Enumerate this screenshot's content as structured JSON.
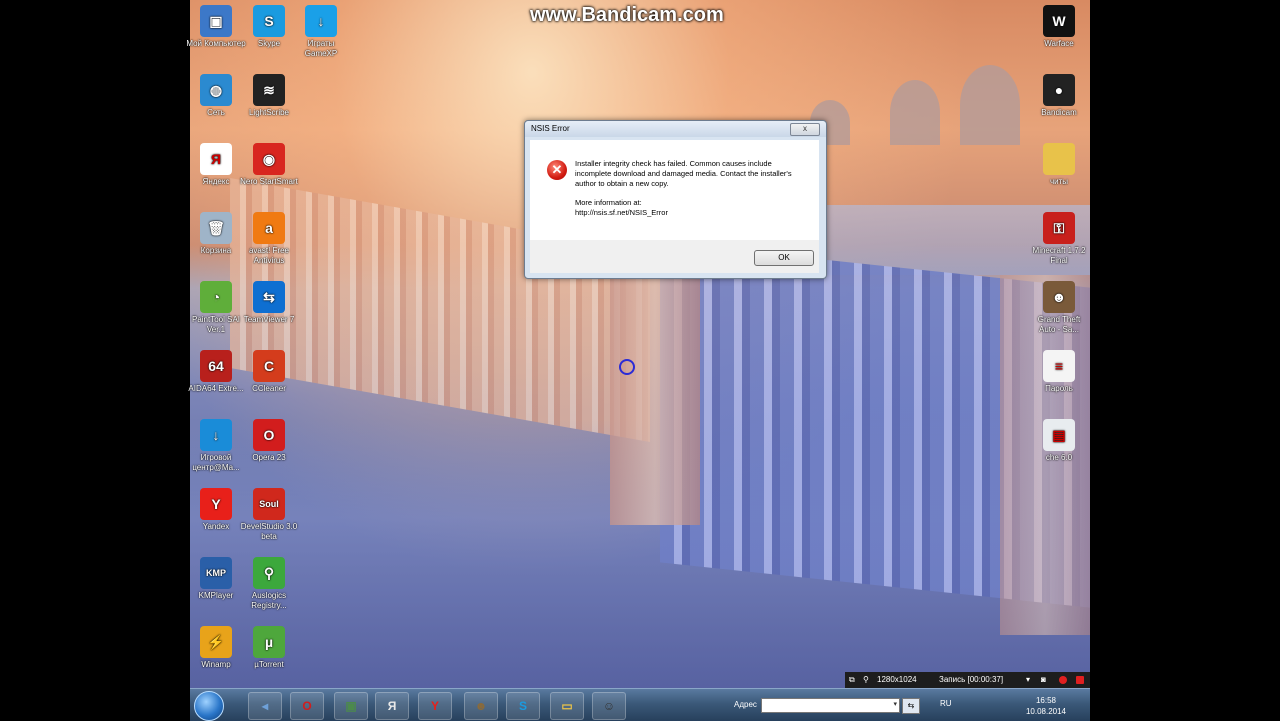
{
  "watermark": "www.Bandicam.com",
  "desktop_icons_left": [
    {
      "label": "Мой Компьютер",
      "icon": "computer-icon",
      "color": "#3c78c8",
      "glyph": "▣"
    },
    {
      "label": "Skype",
      "icon": "skype-icon",
      "color": "#1a9be0",
      "glyph": "S"
    },
    {
      "label": "Играты GameXP",
      "icon": "download-icon",
      "color": "#1aa0e8",
      "glyph": "↓"
    },
    {
      "label": "Сеть",
      "icon": "network-globe-icon",
      "color": "#2b8ad0",
      "glyph": "◍"
    },
    {
      "label": "LightScribe",
      "icon": "lightscribe-icon",
      "color": "#222222",
      "glyph": "≋"
    },
    {
      "label": "Яндекс",
      "icon": "yandex-icon",
      "color": "#ffffff",
      "glyph": "Я"
    },
    {
      "label": "Nero StartSmart",
      "icon": "nero-icon",
      "color": "#d8261f",
      "glyph": "◉"
    },
    {
      "label": "Корзина",
      "icon": "recycle-bin-icon",
      "color": "#9fb4c8",
      "glyph": "🗑"
    },
    {
      "label": "avast! Free Antivirus",
      "icon": "avast-icon",
      "color": "#f07a12",
      "glyph": "a"
    },
    {
      "label": "PaintTool SAI Ver.1",
      "icon": "painttool-sai-icon",
      "color": "#5fae3a",
      "glyph": "◔"
    },
    {
      "label": "TeamViewer 7",
      "icon": "teamviewer-icon",
      "color": "#0e6fd1",
      "glyph": "⇆"
    },
    {
      "label": "AIDA64 Extre...",
      "icon": "aida64-icon",
      "color": "#b8201c",
      "glyph": "64"
    },
    {
      "label": "CCleaner",
      "icon": "ccleaner-icon",
      "color": "#d43c1c",
      "glyph": "C"
    },
    {
      "label": "Игровой центр@Ma...",
      "icon": "game-center-icon",
      "color": "#1a8cd8",
      "glyph": "↓"
    },
    {
      "label": "Opera 23",
      "icon": "opera-icon",
      "color": "#d21d1d",
      "glyph": "O"
    },
    {
      "label": "Yandex",
      "icon": "yandex-browser-icon",
      "color": "#e8201a",
      "glyph": "Y"
    },
    {
      "label": "DevelStudio 3.0 beta",
      "icon": "develstudio-icon",
      "color": "#d0281c",
      "glyph": "Soul"
    },
    {
      "label": "KMPlayer",
      "icon": "kmplayer-icon",
      "color": "#2a5fa8",
      "glyph": "KMP"
    },
    {
      "label": "Auslogics Registry...",
      "icon": "auslogics-icon",
      "color": "#3ca83c",
      "glyph": "⚲"
    },
    {
      "label": "Winamp",
      "icon": "winamp-icon",
      "color": "#e8a31a",
      "glyph": "⚡"
    },
    {
      "label": "µTorrent",
      "icon": "utorrent-icon",
      "color": "#4ea73c",
      "glyph": "µ"
    }
  ],
  "desktop_icons_right": [
    {
      "label": "Warface",
      "icon": "warface-icon",
      "color": "#111111",
      "glyph": "W"
    },
    {
      "label": "Bandicam",
      "icon": "bandicam-icon",
      "color": "#222222",
      "glyph": "●"
    },
    {
      "label": "читы",
      "icon": "folder-icon",
      "color": "#e8c24a",
      "glyph": ""
    },
    {
      "label": "Minecraft 1.7.2 Final",
      "icon": "minecraft-key-icon",
      "color": "#c8201c",
      "glyph": "⚿"
    },
    {
      "label": "Grand Theft Auto - Sa...",
      "icon": "gta-sa-icon",
      "color": "#7a5a3a",
      "glyph": "☻"
    },
    {
      "label": "Пароль",
      "icon": "text-file-icon",
      "color": "#f4f4f4",
      "glyph": "≡"
    },
    {
      "label": "che 6.0",
      "icon": "cheat-engine-icon",
      "color": "#e8ecef",
      "glyph": "▤"
    }
  ],
  "dialog": {
    "title": "NSIS Error",
    "close_label": "x",
    "message_line": "Installer integrity check has failed. Common causes include incomplete download and damaged media. Contact the installer's author to obtain a new copy.",
    "more_info_label": "More information at:",
    "more_info_url": "http://nsis.sf.net/NSIS_Error",
    "ok_label": "OK"
  },
  "bandicam_bar": {
    "resolution": "1280x1024",
    "status": "Запись [00:00:37]"
  },
  "taskbar": {
    "address_label": "Адрес",
    "address_value": "",
    "language": "RU",
    "time": "16:58",
    "date": "10.08.2014",
    "pinned": [
      {
        "name": "volume-icon",
        "glyph": "◂",
        "color": "#6ea0d8"
      },
      {
        "name": "opera-icon",
        "glyph": "O",
        "color": "#d21d1d"
      },
      {
        "name": "monitor-icon",
        "glyph": "▣",
        "color": "#4c8a4c"
      },
      {
        "name": "yandex-icon",
        "glyph": "Я",
        "color": "#e8e8e8"
      },
      {
        "name": "yandex-browser-icon",
        "glyph": "Y",
        "color": "#e8201a"
      },
      {
        "name": "gta-icon",
        "glyph": "☻",
        "color": "#8a6a3a"
      },
      {
        "name": "skype-icon",
        "glyph": "S",
        "color": "#1a9be0"
      },
      {
        "name": "explorer-folder-icon",
        "glyph": "▭",
        "color": "#e8c24a"
      },
      {
        "name": "game-app-icon",
        "glyph": "☺",
        "color": "#333333"
      }
    ]
  }
}
